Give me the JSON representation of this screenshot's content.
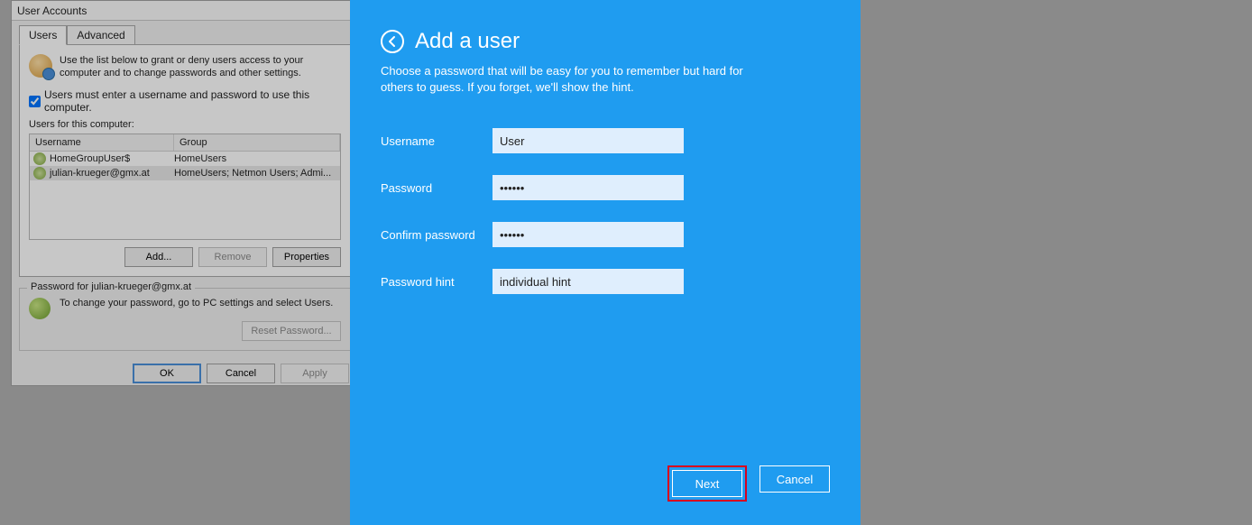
{
  "ua": {
    "title": "User Accounts",
    "tabs": {
      "users": "Users",
      "advanced": "Advanced"
    },
    "intro": "Use the list below to grant or deny users access to your computer and to change passwords and other settings.",
    "must_enter_label": "Users must enter a username and password to use this computer.",
    "list_label": "Users for this computer:",
    "col_username": "Username",
    "col_group": "Group",
    "rows": [
      {
        "user": "HomeGroupUser$",
        "group": "HomeUsers"
      },
      {
        "user": "julian-krueger@gmx.at",
        "group": "HomeUsers; Netmon Users; Admi..."
      }
    ],
    "buttons": {
      "add": "Add...",
      "remove": "Remove",
      "properties": "Properties"
    },
    "pw_group_label": "Password for julian-krueger@gmx.at",
    "pw_text": "To change your password, go to PC settings and select Users.",
    "pw_reset": "Reset Password...",
    "footer": {
      "ok": "OK",
      "cancel": "Cancel",
      "apply": "Apply"
    }
  },
  "modal": {
    "title": "Add a user",
    "description": "Choose a password that will be easy for you to remember but hard for others to guess. If you forget, we'll show the hint.",
    "fields": {
      "username_label": "Username",
      "username_value": "User",
      "password_label": "Password",
      "password_value": "••••••",
      "confirm_label": "Confirm password",
      "confirm_value": "••••••",
      "hint_label": "Password hint",
      "hint_value": "individual hint"
    },
    "buttons": {
      "next": "Next",
      "cancel": "Cancel"
    }
  }
}
